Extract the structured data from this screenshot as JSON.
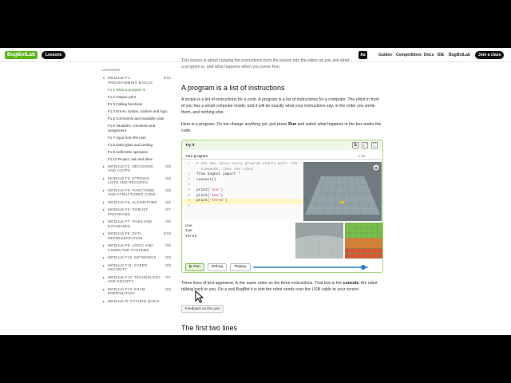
{
  "nav": {
    "logo": "BugBotLab",
    "lessons": "Lessons",
    "aa": "Aa",
    "links": [
      "Guides",
      "Competitions",
      "Docs",
      "IDE",
      "BugBotLab"
    ],
    "join": "Join a class"
  },
  "sidebar": {
    "heading": "LESSONS",
    "module1": {
      "title": "MODULE F1: PROGRAMMING BASICS",
      "count": "0/10"
    },
    "lessons": [
      "F1.1 What a program is",
      "F1.2 Output: print",
      "F1.3 Calling functions",
      "F1.4 Errors: syntax, runtime and logic",
      "F1.5 Comments and readable code",
      "F1.6 Variables, constants and assignment",
      "F1.7 Input from the user",
      "F1.8 Data types and casting",
      "F1.9 Arithmetic operators",
      "F1.10 Project: ask and drive"
    ],
    "modules": [
      {
        "title": "MODULE F2: DECISIONS AND LOOPS",
        "count": "0/8"
      },
      {
        "title": "MODULE F3: STRINGS, LISTS AND RECORDS",
        "count": "0/8"
      },
      {
        "title": "MODULE F4: FUNCTIONS AND STRUCTURED CODE",
        "count": "0/8"
      },
      {
        "title": "MODULE F5: ALGORITHMS",
        "count": "0/9"
      },
      {
        "title": "MODULE F6: ROBUST PROGRAMS",
        "count": "0/7"
      },
      {
        "title": "MODULE F7: FILES AND DATABASES",
        "count": "0/8"
      },
      {
        "title": "MODULE F8: DATA REPRESENTATION",
        "count": "0/10"
      },
      {
        "title": "MODULE F9: LOGIC AND COMPUTER SYSTEMS",
        "count": "0/8"
      },
      {
        "title": "MODULE F10: NETWORKS",
        "count": "0/8"
      },
      {
        "title": "MODULE F11: CYBER SECURITY",
        "count": "0/8"
      },
      {
        "title": "MODULE F12: TECHNOLOGY AND SOCIETY",
        "count": "0/7"
      },
      {
        "title": "MODULE F13: EXAM PREPARATION",
        "count": "0/8"
      },
      {
        "title": "MODULE R: PYTHON QUICK",
        "count": ""
      }
    ]
  },
  "content": {
    "intro_line1": "This lesson is about copying the instructions from the lesson into the editor so you see what",
    "intro_line2": "a program is, and what happens when you press Run.",
    "h1": "A program is a list of instructions",
    "p1": "A recipe is a list of instructions for a cook. A program is a list of instructions for a computer. The robot in front of you has a small computer inside, and it will do exactly what your instructions say, in the order you wrote them, and nothing else.",
    "p2a": "Here is a program. Do not change anything yet; just press ",
    "p2b": "Run",
    "p2c": " and watch what happens in the box under the code.",
    "p3a": "Three lines of text appeared, in the same order as the three instructions. That box is the ",
    "p3b": "console",
    "p3c": ": the robot talking back to you. On a real BugBot it is text the robot sends over the USB cable to your screen.",
    "feedback": "Feedback on this part",
    "h2": "The first two lines"
  },
  "widget": {
    "title": "Try it",
    "tab": "Your program",
    "file": "▸ file",
    "code": [
      {
        "n": "1",
        "t": "# the two lines every program starts with: the",
        "c": true
      },
      {
        "n": "",
        "t": "  commands, then the robot",
        "c": true
      },
      {
        "n": "2",
        "t": "from bugbot import *",
        "c": false
      },
      {
        "n": "3",
        "t": "connect()",
        "c": false
      },
      {
        "n": "4",
        "t": "",
        "c": false
      },
      {
        "n": "5",
        "t": "print('one')",
        "c": false
      },
      {
        "n": "6",
        "t": "print('two')",
        "c": false
      },
      {
        "n": "7",
        "t": "print('three')",
        "c": false
      },
      {
        "n": "8",
        "t": "",
        "c": false
      }
    ],
    "output": [
      "one",
      "two",
      "three"
    ],
    "run": "Run",
    "debug": "Debug",
    "replay": "Replay",
    "speed": 0.96
  },
  "colors": {
    "accent": "#5fb61b",
    "run_border": "#7dbb4a",
    "slider": "#2a7fc2"
  }
}
